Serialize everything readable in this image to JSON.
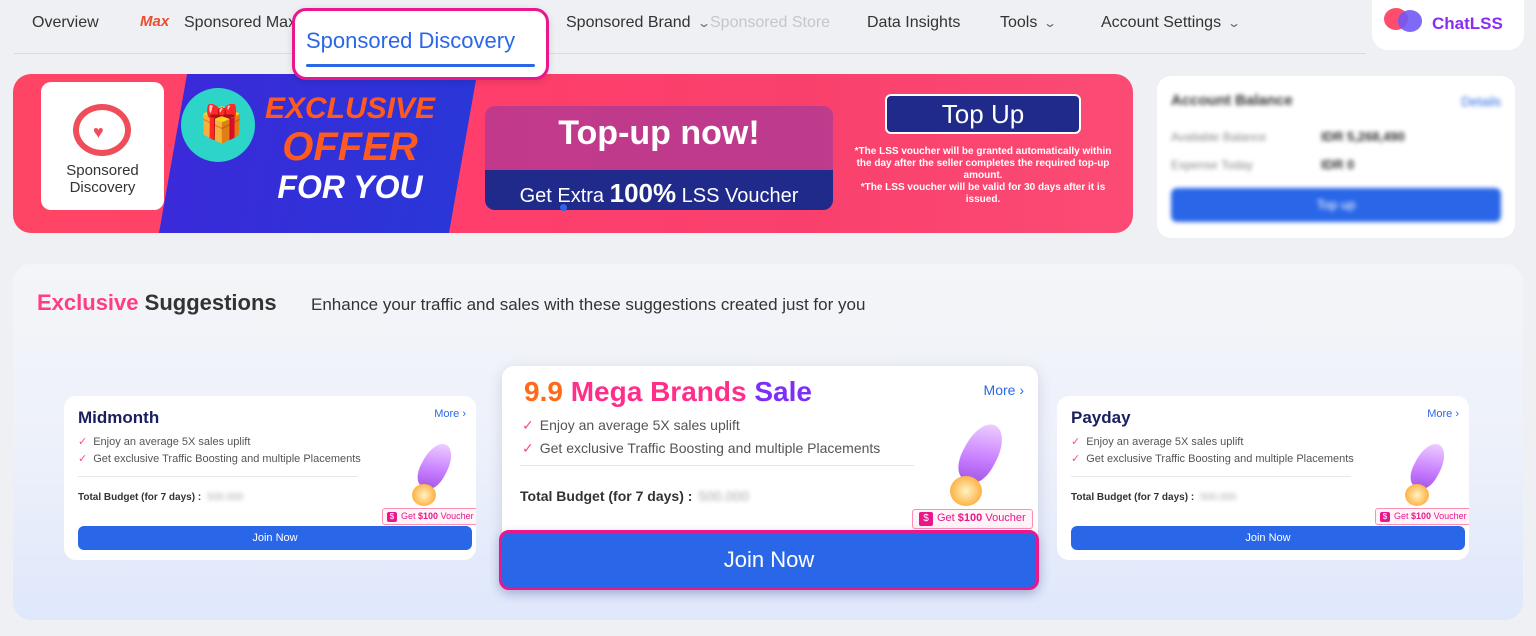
{
  "nav": {
    "overview": "Overview",
    "max_logo": "Max",
    "sponsored_max": "Sponsored Max",
    "sponsored_discovery": "Sponsored Discovery",
    "sponsored_brand": "Sponsored Brand",
    "sponsored_store": "Sponsored Store",
    "data_insights": "Data Insights",
    "tools": "Tools",
    "account_settings": "Account Settings"
  },
  "chatlss": {
    "label": "ChatLSS"
  },
  "banner": {
    "logo_text": "Sponsored Discovery",
    "offer_line1": "EXCLUSIVE",
    "offer_line2": "OFFER",
    "offer_line3": "FOR YOU",
    "headline": "Top-up now!",
    "sub_prefix": "Get Extra",
    "sub_bold": "100%",
    "sub_suffix": "LSS Voucher",
    "button": "Top Up",
    "fine_1": "*The LSS voucher will be granted automatically within the day after the seller completes the required top-up amount.",
    "fine_2": "*The LSS voucher will be valid for 30 days after it is issued."
  },
  "account": {
    "title": "Account Balance",
    "details": "Details",
    "available_label": "Available Balance",
    "available_value": "IDR 5,268,490",
    "expense_label": "Expense Today",
    "expense_value": "IDR 0",
    "button": "Top up"
  },
  "suggestions": {
    "title_highlight": "Exclusive",
    "title_rest": "Suggestions",
    "subtitle": "Enhance your traffic and sales with these suggestions created just for you",
    "cards": [
      {
        "title": "Midmonth",
        "more": "More",
        "features": [
          "Enjoy an average 5X sales uplift",
          "Get exclusive Traffic Boosting and multiple Placements"
        ],
        "budget_label": "Total Budget (for 7 days) :",
        "budget_value": "500.000",
        "voucher_prefix": "Get",
        "voucher_amount": "$100",
        "voucher_suffix": "Voucher",
        "join": "Join Now"
      },
      {
        "title_num": "9.9",
        "title_mid": "Mega Brands",
        "title_end": "Sale",
        "more": "More",
        "features": [
          "Enjoy an average 5X sales uplift",
          "Get exclusive Traffic Boosting and multiple Placements"
        ],
        "budget_label": "Total Budget (for 7 days) :",
        "budget_value": "500.000",
        "voucher_prefix": "Get",
        "voucher_amount": "$100",
        "voucher_suffix": "Voucher",
        "join": "Join Now"
      },
      {
        "title": "Payday",
        "more": "More",
        "features": [
          "Enjoy an average 5X sales uplift",
          "Get exclusive Traffic Boosting and multiple Placements"
        ],
        "budget_label": "Total Budget (for 7 days) :",
        "budget_value": "500.000",
        "voucher_prefix": "Get",
        "voucher_amount": "$100",
        "voucher_suffix": "Voucher",
        "join": "Join Now"
      }
    ]
  },
  "colors": {
    "primary_blue": "#2a67e8",
    "highlight_pink": "#e9168c",
    "banner_red": "#ff4566"
  }
}
